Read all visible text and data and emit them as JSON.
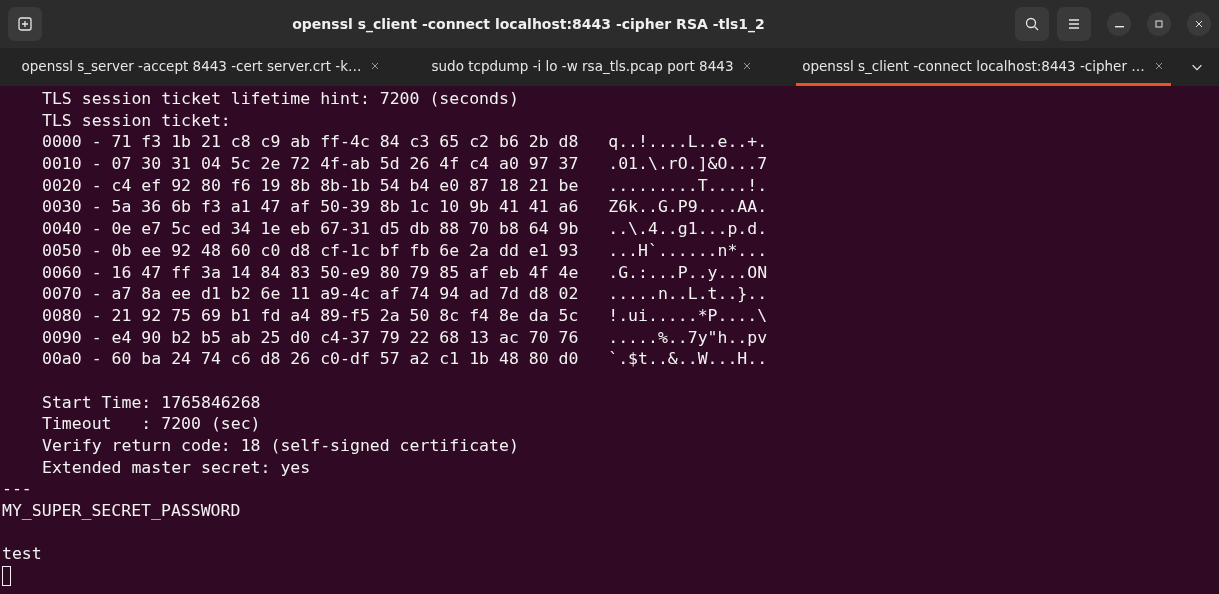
{
  "window": {
    "title": "openssl s_client -connect localhost:8443 -cipher RSA -tls1_2"
  },
  "tabs": [
    {
      "label": "openssl s_server -accept 8443 -cert server.crt -k…",
      "selected": false
    },
    {
      "label": "sudo tcpdump -i lo -w rsa_tls.pcap port 8443",
      "selected": false
    },
    {
      "label": "openssl s_client -connect localhost:8443 -cipher …",
      "selected": true
    }
  ],
  "terminal": {
    "lines": [
      {
        "text": "TLS session ticket lifetime hint: 7200 (seconds)",
        "indented": true,
        "gap_before": false
      },
      {
        "text": "TLS session ticket:",
        "indented": true,
        "gap_before": false
      },
      {
        "text": "0000 - 71 f3 1b 21 c8 c9 ab ff-4c 84 c3 65 c2 b6 2b d8   q..!....L..e..+.",
        "indented": true,
        "gap_before": false
      },
      {
        "text": "0010 - 07 30 31 04 5c 2e 72 4f-ab 5d 26 4f c4 a0 97 37   .01.\\.rO.]&O...7",
        "indented": true,
        "gap_before": false
      },
      {
        "text": "0020 - c4 ef 92 80 f6 19 8b 8b-1b 54 b4 e0 87 18 21 be   .........T....!.",
        "indented": true,
        "gap_before": false
      },
      {
        "text": "0030 - 5a 36 6b f3 a1 47 af 50-39 8b 1c 10 9b 41 41 a6   Z6k..G.P9....AA.",
        "indented": true,
        "gap_before": false
      },
      {
        "text": "0040 - 0e e7 5c ed 34 1e eb 67-31 d5 db 88 70 b8 64 9b   ..\\.4..g1...p.d.",
        "indented": true,
        "gap_before": false
      },
      {
        "text": "0050 - 0b ee 92 48 60 c0 d8 cf-1c bf fb 6e 2a dd e1 93   ...H`......n*...",
        "indented": true,
        "gap_before": false
      },
      {
        "text": "0060 - 16 47 ff 3a 14 84 83 50-e9 80 79 85 af eb 4f 4e   .G.:...P..y...ON",
        "indented": true,
        "gap_before": false
      },
      {
        "text": "0070 - a7 8a ee d1 b2 6e 11 a9-4c af 74 94 ad 7d d8 02   .....n..L.t..}..",
        "indented": true,
        "gap_before": false
      },
      {
        "text": "0080 - 21 92 75 69 b1 fd a4 89-f5 2a 50 8c f4 8e da 5c   !.ui.....*P....\\",
        "indented": true,
        "gap_before": false
      },
      {
        "text": "0090 - e4 90 b2 b5 ab 25 d0 c4-37 79 22 68 13 ac 70 76   .....%..7y\"h..pv",
        "indented": true,
        "gap_before": false
      },
      {
        "text": "00a0 - 60 ba 24 74 c6 d8 26 c0-df 57 a2 c1 1b 48 80 d0   `.$t..&..W...H..",
        "indented": true,
        "gap_before": false
      },
      {
        "text": "Start Time: 1765846268",
        "indented": true,
        "gap_before": true
      },
      {
        "text": "Timeout   : 7200 (sec)",
        "indented": true,
        "gap_before": false
      },
      {
        "text": "Verify return code: 18 (self-signed certificate)",
        "indented": true,
        "gap_before": false
      },
      {
        "text": "Extended master secret: yes",
        "indented": true,
        "gap_before": false
      },
      {
        "text": "---",
        "indented": false,
        "gap_before": false
      },
      {
        "text": "MY_SUPER_SECRET_PASSWORD",
        "indented": false,
        "gap_before": false
      },
      {
        "text": "test",
        "indented": false,
        "gap_before": true
      }
    ]
  }
}
